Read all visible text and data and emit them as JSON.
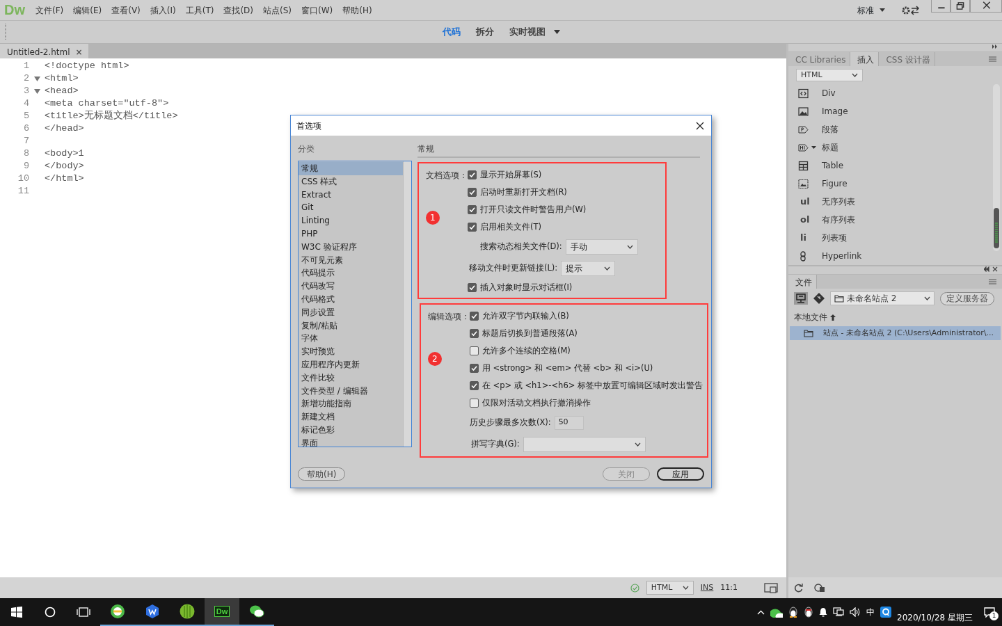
{
  "app": {
    "logo": "Dw",
    "menus": [
      "文件(F)",
      "编辑(E)",
      "查看(V)",
      "插入(I)",
      "工具(T)",
      "查找(D)",
      "站点(S)",
      "窗口(W)",
      "帮助(H)"
    ],
    "workspace": "标准"
  },
  "view_switcher": [
    {
      "label": "代码",
      "selected": true,
      "has_menu": false
    },
    {
      "label": "拆分",
      "selected": false,
      "has_menu": false
    },
    {
      "label": "实时视图",
      "selected": false,
      "has_menu": true
    }
  ],
  "document_tab": {
    "title": "Untitled-2.html",
    "close": "×"
  },
  "code_lines": [
    {
      "number": "1",
      "text": "<!doctype html>",
      "foldable": false
    },
    {
      "number": "2",
      "text": "<html>",
      "foldable": true
    },
    {
      "number": "3",
      "text": "<head>",
      "foldable": true
    },
    {
      "number": "4",
      "text": "<meta charset=\"utf-8\">",
      "foldable": false
    },
    {
      "number": "5",
      "text": "<title>无标题文档</title>",
      "foldable": false
    },
    {
      "number": "6",
      "text": "</head>",
      "foldable": false
    },
    {
      "number": "7",
      "foldable": false
    },
    {
      "number": "8",
      "text": "<body>1",
      "foldable": false
    },
    {
      "number": "9",
      "text": "</body>",
      "foldable": false
    },
    {
      "number": "10",
      "text": "</html>",
      "foldable": false
    },
    {
      "number": "11",
      "foldable": false
    }
  ],
  "status_bar": {
    "doc_type": "HTML",
    "mode": "INS",
    "position": "11:1"
  },
  "insert_panel": {
    "tabs": [
      {
        "label": "CC Libraries",
        "selected": false
      },
      {
        "label": "插入",
        "selected": true
      },
      {
        "label": "CSS 设计器",
        "selected": false
      }
    ],
    "category": "HTML",
    "items": [
      {
        "kind": "div",
        "label": "Div"
      },
      {
        "kind": "image",
        "label": "Image"
      },
      {
        "kind": "paragraph",
        "label": "段落"
      },
      {
        "kind": "heading",
        "label": "标题",
        "has_menu": true
      },
      {
        "kind": "table",
        "label": "Table"
      },
      {
        "kind": "figure",
        "label": "Figure"
      },
      {
        "kind": "glyph",
        "glyph": "ul",
        "label": "无序列表"
      },
      {
        "kind": "glyph",
        "glyph": "ol",
        "label": "有序列表"
      },
      {
        "kind": "glyph",
        "glyph": "li",
        "label": "列表项"
      },
      {
        "kind": "hyperlink",
        "label": "Hyperlink"
      }
    ]
  },
  "files_panel": {
    "tab": "文件",
    "site": "未命名站点 2",
    "server_button": "定义服务器",
    "column": "本地文件",
    "rows": [
      {
        "label": "站点 - 未命名站点 2 (C:\\Users\\Administrator\\...",
        "selected": true
      }
    ]
  },
  "dialog": {
    "title": "首选项",
    "category_heading": "分类",
    "categories": [
      {
        "label": "常规",
        "selected": true
      },
      {
        "label": "CSS 样式",
        "selected": false
      },
      {
        "label": "Extract",
        "selected": false
      },
      {
        "label": "Git",
        "selected": false
      },
      {
        "label": "Linting",
        "selected": false
      },
      {
        "label": "PHP",
        "selected": false
      },
      {
        "label": "W3C 验证程序",
        "selected": false
      },
      {
        "label": "不可见元素",
        "selected": false
      },
      {
        "label": "代码提示",
        "selected": false
      },
      {
        "label": "代码改写",
        "selected": false
      },
      {
        "label": "代码格式",
        "selected": false
      },
      {
        "label": "同步设置",
        "selected": false
      },
      {
        "label": "复制/粘贴",
        "selected": false
      },
      {
        "label": "字体",
        "selected": false
      },
      {
        "label": "实时预览",
        "selected": false
      },
      {
        "label": "应用程序内更新",
        "selected": false
      },
      {
        "label": "文件比较",
        "selected": false
      },
      {
        "label": "文件类型 / 编辑器",
        "selected": false
      },
      {
        "label": "新增功能指南",
        "selected": false
      },
      {
        "label": "新建文档",
        "selected": false
      },
      {
        "label": "标记色彩",
        "selected": false
      },
      {
        "label": "界面",
        "selected": false
      }
    ],
    "section_title": "常规",
    "groups": [
      {
        "label": "文档选项：",
        "marker": "1",
        "rows": [
          {
            "kind": "checkbox",
            "label": "显示开始屏幕(S)",
            "checked": true
          },
          {
            "kind": "checkbox",
            "label": "启动时重新打开文档(R)",
            "checked": true
          },
          {
            "kind": "checkbox",
            "label": "打开只读文件时警告用户(W)",
            "checked": true
          },
          {
            "kind": "checkbox",
            "label": "启用相关文件(T)",
            "checked": true
          },
          {
            "kind": "select",
            "label": "搜索动态相关文件(D):",
            "value": "手动",
            "indented": true
          },
          {
            "kind": "select",
            "label": "移动文件时更新链接(L):",
            "value": "提示",
            "indented": false
          },
          {
            "kind": "checkbox",
            "label": "插入对象时显示对话框(I)",
            "checked": true
          }
        ]
      },
      {
        "label": "编辑选项：",
        "marker": "2",
        "rows": [
          {
            "kind": "checkbox",
            "label": "允许双字节内联输入(B)",
            "checked": true
          },
          {
            "kind": "checkbox",
            "label": "标题后切换到普通段落(A)",
            "checked": true
          },
          {
            "kind": "checkbox",
            "label": "允许多个连续的空格(M)",
            "checked": false
          },
          {
            "kind": "checkbox",
            "label": "用 <strong> 和 <em> 代替 <b> 和 <i>(U)",
            "checked": true
          },
          {
            "kind": "checkbox",
            "label": "在 <p> 或 <h1>-<h6> 标签中放置可编辑区域时发出警告",
            "checked": true
          },
          {
            "kind": "checkbox",
            "label": "仅限对活动文档执行撤消操作",
            "checked": false
          },
          {
            "kind": "number",
            "label": "历史步骤最多次数(X):",
            "value": "50"
          },
          {
            "kind": "select",
            "label": "拼写字典(G):",
            "indented": false
          }
        ]
      }
    ],
    "buttons": [
      {
        "label": "帮助(H)",
        "disabled": false,
        "default": false
      },
      {
        "label": "关闭",
        "disabled": true,
        "default": false
      },
      {
        "label": "应用",
        "disabled": false,
        "default": true
      }
    ]
  },
  "taskbar": {
    "apps": [
      {
        "kind": "browser",
        "active": false
      },
      {
        "kind": "office",
        "active": false
      },
      {
        "kind": "media",
        "active": false
      },
      {
        "kind": "dreamweaver",
        "text": "Dw",
        "active": true
      },
      {
        "kind": "chat",
        "active": false
      }
    ],
    "ime": "中",
    "date": "2020/10/28 星期三",
    "notifications": "1"
  }
}
